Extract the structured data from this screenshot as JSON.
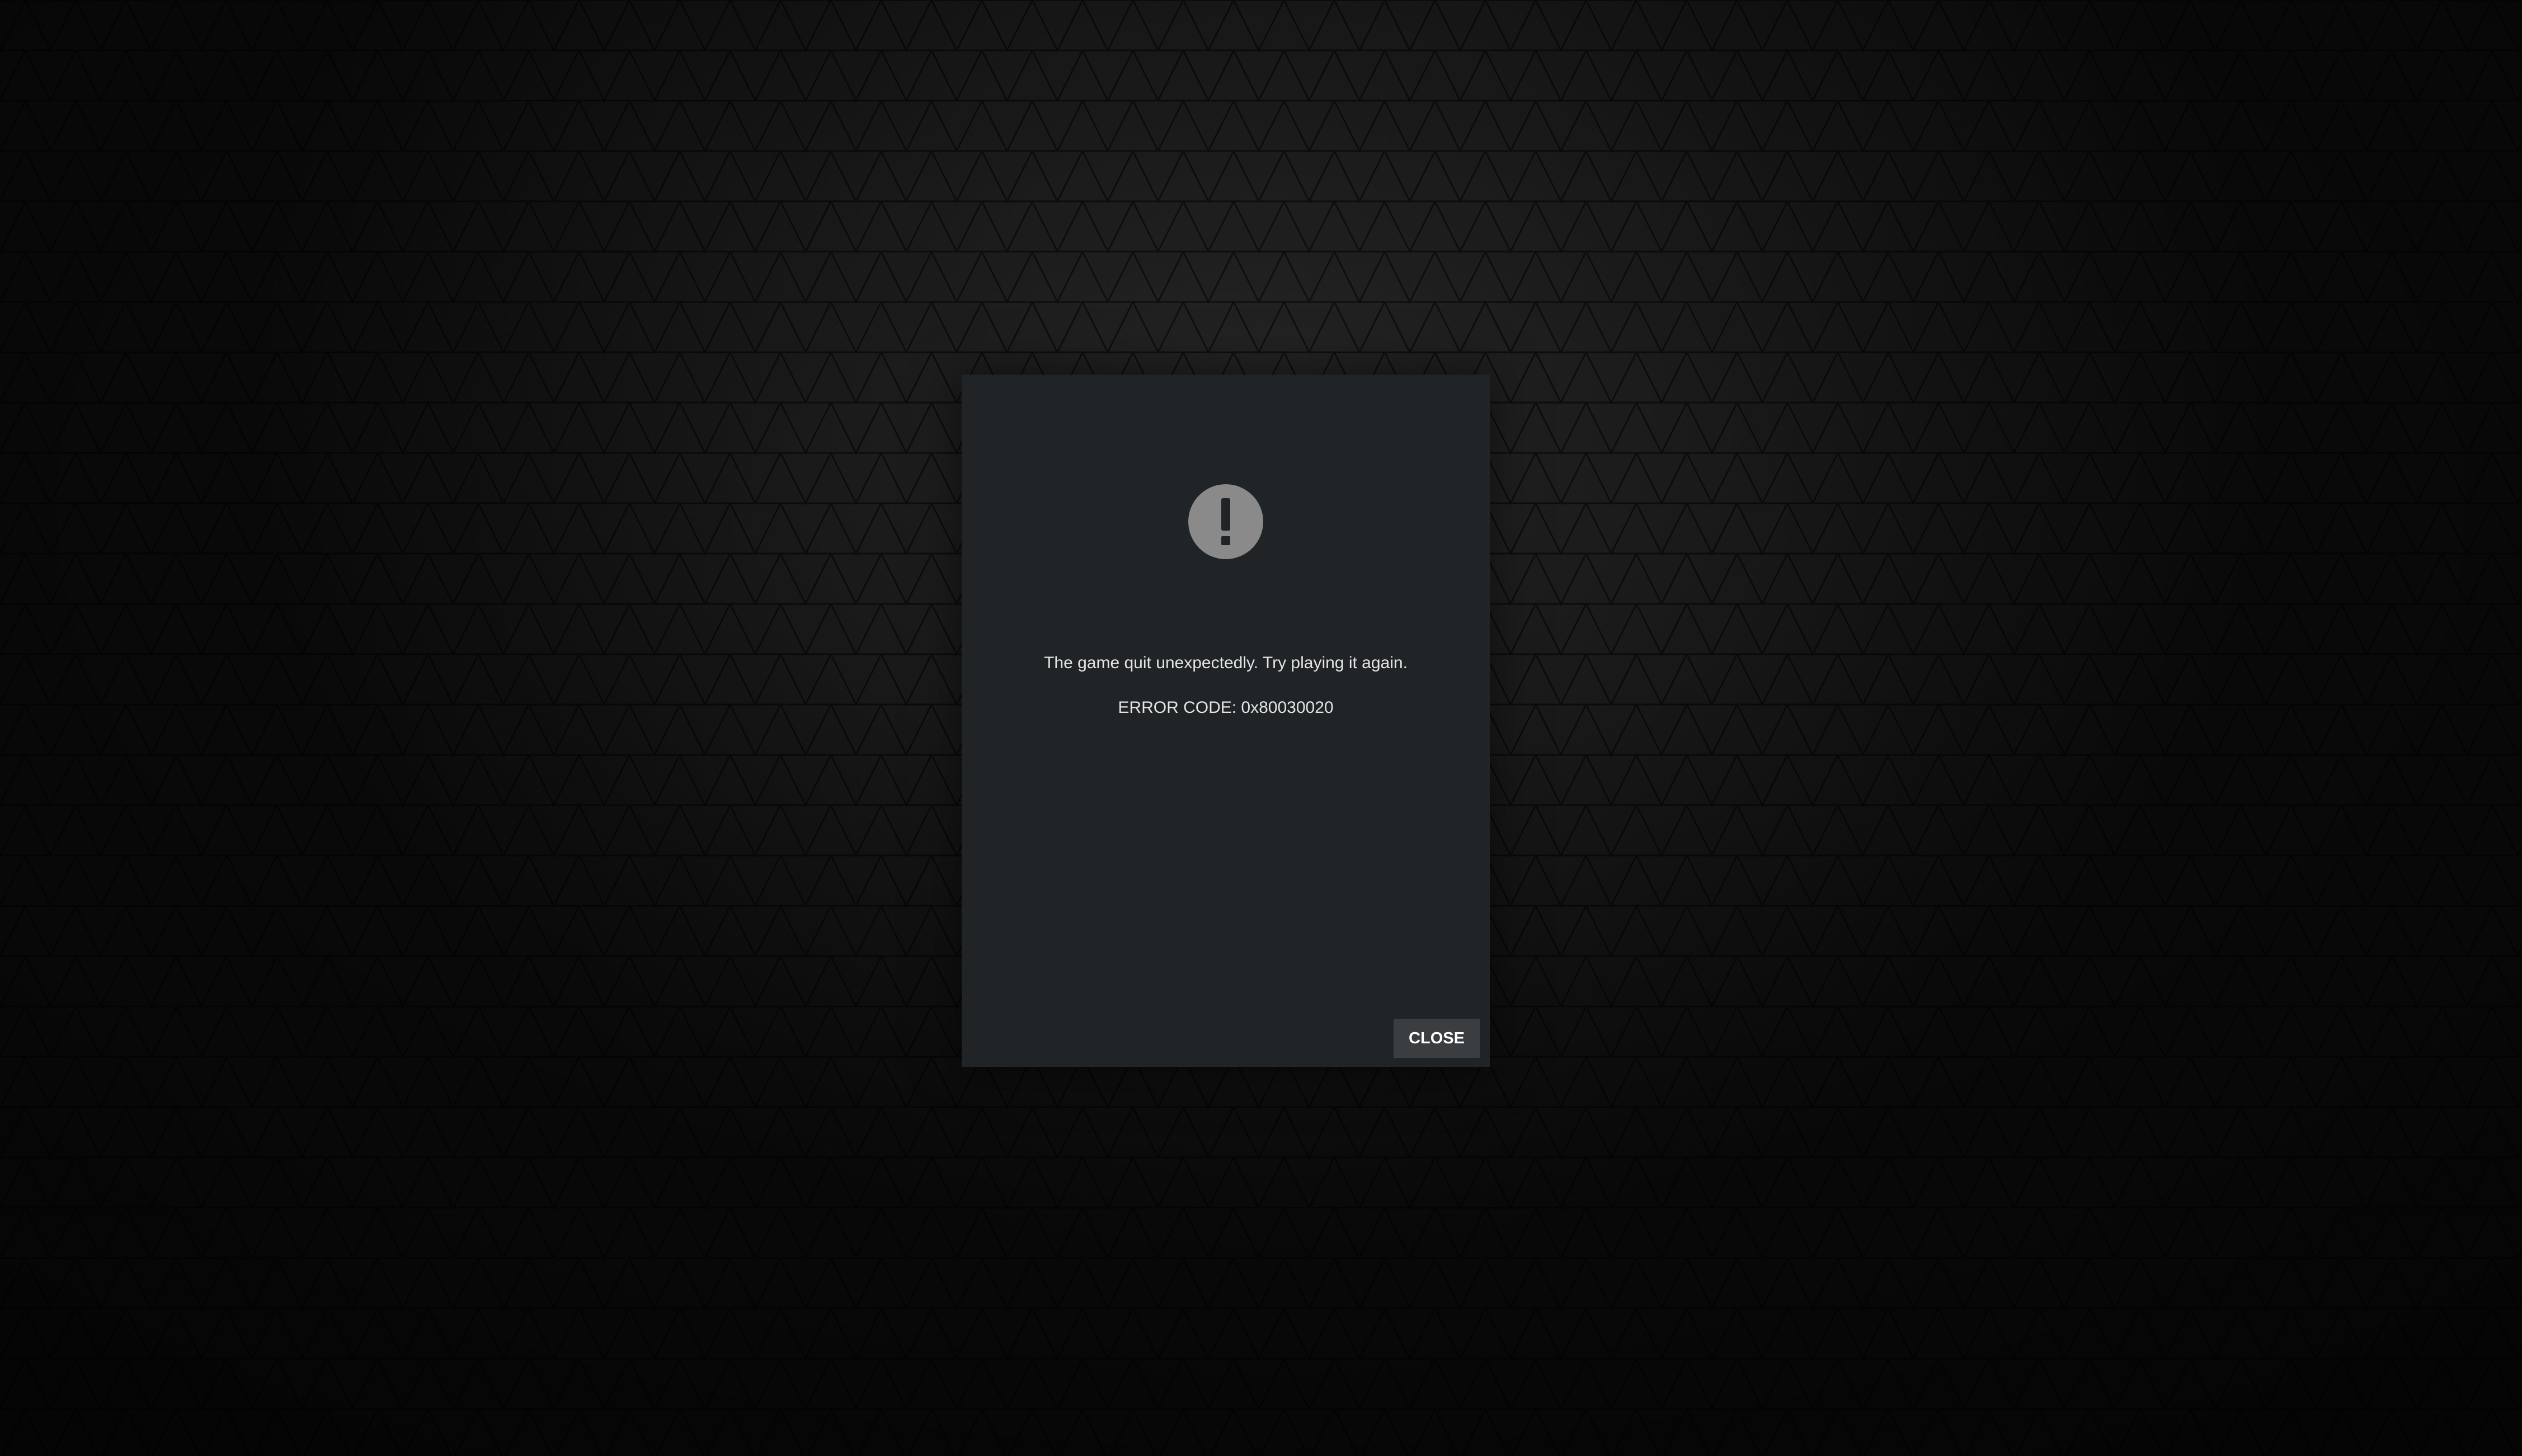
{
  "dialog": {
    "icon": "exclamation-circle-icon",
    "message": "The game quit unexpectedly. Try playing it again.",
    "error_code": "ERROR CODE: 0x80030020",
    "close_label": "CLOSE"
  },
  "colors": {
    "background": "#141414",
    "dialog_background": "#202426",
    "icon": "#8a8a8a",
    "text": "#e2e4e5",
    "button_background": "#3a3e41",
    "button_text": "#ffffff"
  }
}
